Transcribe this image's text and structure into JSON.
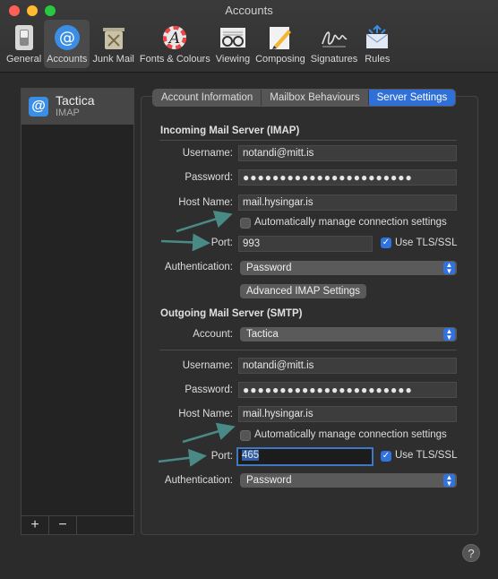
{
  "window": {
    "title": "Accounts",
    "colors": {
      "close": "#ff5f57",
      "minimize": "#febc2e",
      "zoom": "#28c840",
      "accent": "#2f72e0"
    }
  },
  "toolbar": {
    "items": [
      {
        "label": "General",
        "icon": "general-switch-icon"
      },
      {
        "label": "Accounts",
        "icon": "at-sign-icon"
      },
      {
        "label": "Junk Mail",
        "icon": "junk-bin-icon"
      },
      {
        "label": "Fonts & Colours",
        "icon": "fonts-colours-icon"
      },
      {
        "label": "Viewing",
        "icon": "glasses-icon"
      },
      {
        "label": "Composing",
        "icon": "pencil-icon"
      },
      {
        "label": "Signatures",
        "icon": "signature-icon"
      },
      {
        "label": "Rules",
        "icon": "rules-envelope-icon"
      }
    ],
    "selected": "Accounts"
  },
  "sidebar": {
    "account_name": "Tactica",
    "account_type": "IMAP",
    "add_label": "+",
    "remove_label": "−"
  },
  "tabs": {
    "items": [
      "Account Information",
      "Mailbox Behaviours",
      "Server Settings"
    ],
    "selected": "Server Settings"
  },
  "incoming": {
    "title": "Incoming Mail Server (IMAP)",
    "username_label": "Username:",
    "username": "notandi@mitt.is",
    "password_label": "Password:",
    "password": "●●●●●●●●●●●●●●●●●●●●●●●",
    "host_label": "Host Name:",
    "host": "mail.hysingar.is",
    "auto_manage_label": "Automatically manage connection settings",
    "auto_manage_checked": false,
    "port_label": "Port:",
    "port": "993",
    "tls_label": "Use TLS/SSL",
    "tls_checked": true,
    "auth_label": "Authentication:",
    "auth": "Password",
    "advanced_button": "Advanced IMAP Settings"
  },
  "outgoing": {
    "title": "Outgoing Mail Server (SMTP)",
    "account_label": "Account:",
    "account": "Tactica",
    "username_label": "Username:",
    "username": "notandi@mitt.is",
    "password_label": "Password:",
    "password": "●●●●●●●●●●●●●●●●●●●●●●●",
    "host_label": "Host Name:",
    "host": "mail.hysingar.is",
    "auto_manage_label": "Automatically manage connection settings",
    "auto_manage_checked": false,
    "port_label": "Port:",
    "port": "465",
    "tls_label": "Use TLS/SSL",
    "tls_checked": true,
    "auth_label": "Authentication:",
    "auth": "Password"
  },
  "help_label": "?"
}
